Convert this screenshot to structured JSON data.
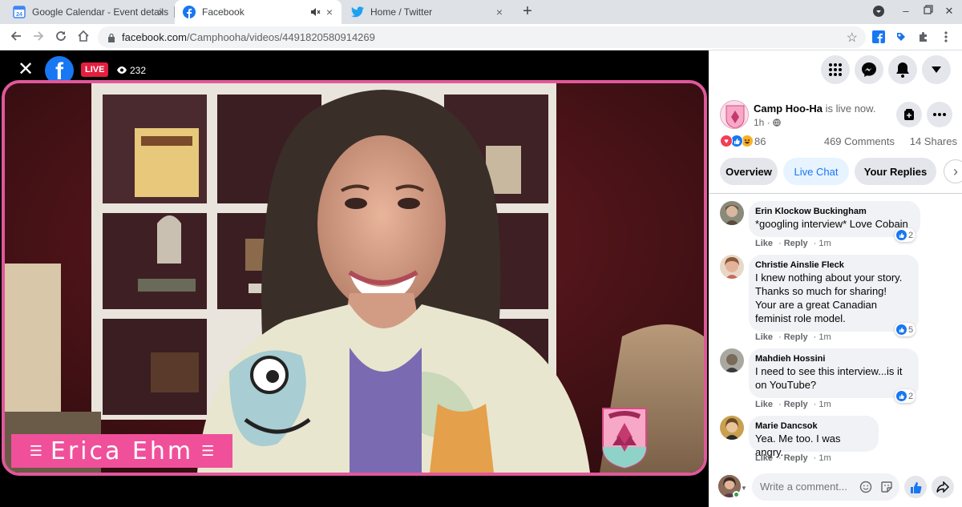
{
  "browser": {
    "tabs": [
      {
        "title": "Google Calendar - Event details",
        "icon": "google-calendar-icon",
        "active": false
      },
      {
        "title": "Facebook",
        "icon": "facebook-icon",
        "active": true,
        "muted": true
      },
      {
        "title": "Home / Twitter",
        "icon": "twitter-icon",
        "active": false
      }
    ],
    "url_domain": "facebook.com",
    "url_path": "/Camphooha/videos/4491820580914269",
    "calendar_favicon_text": "24"
  },
  "video": {
    "live_label": "LIVE",
    "viewer_count": "232",
    "nameplate": "Erica Ehm",
    "logo_letter": "f"
  },
  "post": {
    "page_name": "Camp Hoo-Ha",
    "status_text": "is live now.",
    "time": "1h",
    "reaction_count": "86",
    "comments_count": "469 Comments",
    "shares_count": "14 Shares"
  },
  "tabs": [
    {
      "label": "Overview",
      "active": false
    },
    {
      "label": "Live Chat",
      "active": true
    },
    {
      "label": "Your Replies",
      "active": false
    }
  ],
  "comments": [
    {
      "author": "Erin Klockow Buckingham",
      "lines": [
        "*googling interview* Love Cobain"
      ],
      "likes": "2",
      "like": "Like",
      "reply": "Reply",
      "time": "1m"
    },
    {
      "author": "Christie Ainslie Fleck",
      "lines": [
        "I knew nothing about your story.",
        "Thanks so much for sharing!",
        "Your are a great Canadian",
        "feminist role model."
      ],
      "likes": "5",
      "like": "Like",
      "reply": "Reply",
      "time": "1m"
    },
    {
      "author": "Mahdieh Hossini",
      "lines": [
        "I need to see this interview...is it",
        "on YouTube?"
      ],
      "likes": "2",
      "like": "Like",
      "reply": "Reply",
      "time": "1m"
    },
    {
      "author": "Marie Dancsok",
      "lines": [
        "Yea. Me too. I was angry."
      ],
      "likes": "",
      "like": "Like",
      "reply": "Reply",
      "time": "1m"
    }
  ],
  "composer": {
    "placeholder": "Write a comment..."
  },
  "colors": {
    "facebook_blue": "#1877f2",
    "live_red": "#e41e3f",
    "frame_pink": "#e0589a",
    "nameplate_pink": "#f0509a"
  }
}
